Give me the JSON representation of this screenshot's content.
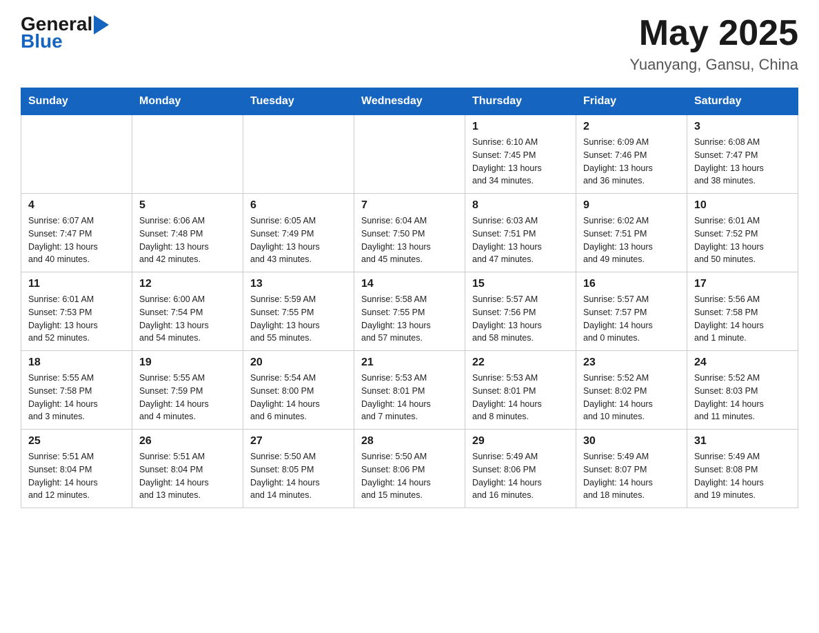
{
  "header": {
    "logo_general": "General",
    "logo_blue": "Blue",
    "title": "May 2025",
    "subtitle": "Yuanyang, Gansu, China"
  },
  "weekdays": [
    "Sunday",
    "Monday",
    "Tuesday",
    "Wednesday",
    "Thursday",
    "Friday",
    "Saturday"
  ],
  "weeks": [
    [
      {
        "day": "",
        "info": ""
      },
      {
        "day": "",
        "info": ""
      },
      {
        "day": "",
        "info": ""
      },
      {
        "day": "",
        "info": ""
      },
      {
        "day": "1",
        "info": "Sunrise: 6:10 AM\nSunset: 7:45 PM\nDaylight: 13 hours\nand 34 minutes."
      },
      {
        "day": "2",
        "info": "Sunrise: 6:09 AM\nSunset: 7:46 PM\nDaylight: 13 hours\nand 36 minutes."
      },
      {
        "day": "3",
        "info": "Sunrise: 6:08 AM\nSunset: 7:47 PM\nDaylight: 13 hours\nand 38 minutes."
      }
    ],
    [
      {
        "day": "4",
        "info": "Sunrise: 6:07 AM\nSunset: 7:47 PM\nDaylight: 13 hours\nand 40 minutes."
      },
      {
        "day": "5",
        "info": "Sunrise: 6:06 AM\nSunset: 7:48 PM\nDaylight: 13 hours\nand 42 minutes."
      },
      {
        "day": "6",
        "info": "Sunrise: 6:05 AM\nSunset: 7:49 PM\nDaylight: 13 hours\nand 43 minutes."
      },
      {
        "day": "7",
        "info": "Sunrise: 6:04 AM\nSunset: 7:50 PM\nDaylight: 13 hours\nand 45 minutes."
      },
      {
        "day": "8",
        "info": "Sunrise: 6:03 AM\nSunset: 7:51 PM\nDaylight: 13 hours\nand 47 minutes."
      },
      {
        "day": "9",
        "info": "Sunrise: 6:02 AM\nSunset: 7:51 PM\nDaylight: 13 hours\nand 49 minutes."
      },
      {
        "day": "10",
        "info": "Sunrise: 6:01 AM\nSunset: 7:52 PM\nDaylight: 13 hours\nand 50 minutes."
      }
    ],
    [
      {
        "day": "11",
        "info": "Sunrise: 6:01 AM\nSunset: 7:53 PM\nDaylight: 13 hours\nand 52 minutes."
      },
      {
        "day": "12",
        "info": "Sunrise: 6:00 AM\nSunset: 7:54 PM\nDaylight: 13 hours\nand 54 minutes."
      },
      {
        "day": "13",
        "info": "Sunrise: 5:59 AM\nSunset: 7:55 PM\nDaylight: 13 hours\nand 55 minutes."
      },
      {
        "day": "14",
        "info": "Sunrise: 5:58 AM\nSunset: 7:55 PM\nDaylight: 13 hours\nand 57 minutes."
      },
      {
        "day": "15",
        "info": "Sunrise: 5:57 AM\nSunset: 7:56 PM\nDaylight: 13 hours\nand 58 minutes."
      },
      {
        "day": "16",
        "info": "Sunrise: 5:57 AM\nSunset: 7:57 PM\nDaylight: 14 hours\nand 0 minutes."
      },
      {
        "day": "17",
        "info": "Sunrise: 5:56 AM\nSunset: 7:58 PM\nDaylight: 14 hours\nand 1 minute."
      }
    ],
    [
      {
        "day": "18",
        "info": "Sunrise: 5:55 AM\nSunset: 7:58 PM\nDaylight: 14 hours\nand 3 minutes."
      },
      {
        "day": "19",
        "info": "Sunrise: 5:55 AM\nSunset: 7:59 PM\nDaylight: 14 hours\nand 4 minutes."
      },
      {
        "day": "20",
        "info": "Sunrise: 5:54 AM\nSunset: 8:00 PM\nDaylight: 14 hours\nand 6 minutes."
      },
      {
        "day": "21",
        "info": "Sunrise: 5:53 AM\nSunset: 8:01 PM\nDaylight: 14 hours\nand 7 minutes."
      },
      {
        "day": "22",
        "info": "Sunrise: 5:53 AM\nSunset: 8:01 PM\nDaylight: 14 hours\nand 8 minutes."
      },
      {
        "day": "23",
        "info": "Sunrise: 5:52 AM\nSunset: 8:02 PM\nDaylight: 14 hours\nand 10 minutes."
      },
      {
        "day": "24",
        "info": "Sunrise: 5:52 AM\nSunset: 8:03 PM\nDaylight: 14 hours\nand 11 minutes."
      }
    ],
    [
      {
        "day": "25",
        "info": "Sunrise: 5:51 AM\nSunset: 8:04 PM\nDaylight: 14 hours\nand 12 minutes."
      },
      {
        "day": "26",
        "info": "Sunrise: 5:51 AM\nSunset: 8:04 PM\nDaylight: 14 hours\nand 13 minutes."
      },
      {
        "day": "27",
        "info": "Sunrise: 5:50 AM\nSunset: 8:05 PM\nDaylight: 14 hours\nand 14 minutes."
      },
      {
        "day": "28",
        "info": "Sunrise: 5:50 AM\nSunset: 8:06 PM\nDaylight: 14 hours\nand 15 minutes."
      },
      {
        "day": "29",
        "info": "Sunrise: 5:49 AM\nSunset: 8:06 PM\nDaylight: 14 hours\nand 16 minutes."
      },
      {
        "day": "30",
        "info": "Sunrise: 5:49 AM\nSunset: 8:07 PM\nDaylight: 14 hours\nand 18 minutes."
      },
      {
        "day": "31",
        "info": "Sunrise: 5:49 AM\nSunset: 8:08 PM\nDaylight: 14 hours\nand 19 minutes."
      }
    ]
  ]
}
